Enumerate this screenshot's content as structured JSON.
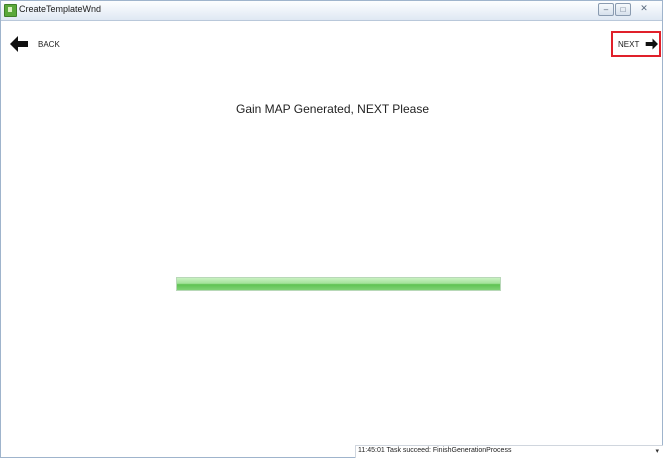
{
  "window": {
    "title": "CreateTemplateWnd"
  },
  "titlebar_buttons": {
    "minimize": "–",
    "maximize": "□",
    "close": "✕"
  },
  "nav": {
    "back": {
      "label": "BACK",
      "icon": "arrow-left-icon"
    },
    "next": {
      "label": "NEXT",
      "icon": "arrow-right-icon",
      "highlight_color": "#e0202a"
    }
  },
  "main": {
    "message": "Gain MAP Generated, NEXT Please"
  },
  "progress": {
    "value": 1.0,
    "color": "#5fc253"
  },
  "status_bar": {
    "text": "11:45:01 Task succeed: FinishGenerationProcess",
    "dropdown_icon": "▾"
  }
}
